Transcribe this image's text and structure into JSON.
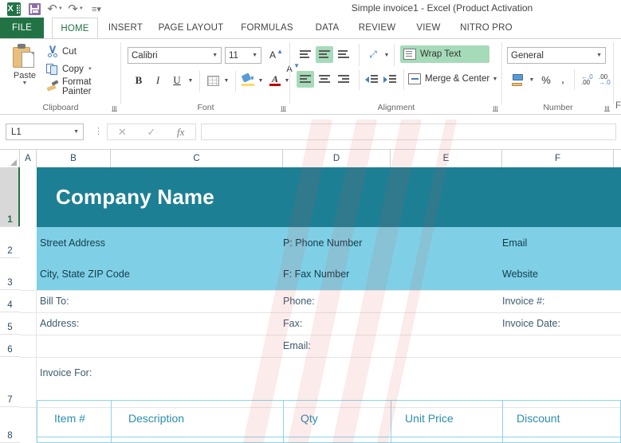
{
  "window": {
    "title": "Simple invoice1 - Excel (Product Activation",
    "quick_access": [
      {
        "name": "save-icon",
        "label": "Save"
      },
      {
        "name": "undo-icon",
        "label": "Undo"
      },
      {
        "name": "redo-icon",
        "label": "Redo"
      },
      {
        "name": "customize-qat-icon",
        "label": "Customize Quick Access Toolbar"
      }
    ]
  },
  "tabs": [
    {
      "label": "FILE",
      "active": false
    },
    {
      "label": "HOME",
      "active": true
    },
    {
      "label": "INSERT",
      "active": false
    },
    {
      "label": "PAGE LAYOUT",
      "active": false
    },
    {
      "label": "FORMULAS",
      "active": false
    },
    {
      "label": "DATA",
      "active": false
    },
    {
      "label": "REVIEW",
      "active": false
    },
    {
      "label": "VIEW",
      "active": false
    },
    {
      "label": "NITRO PRO",
      "active": false
    }
  ],
  "ribbon": {
    "clipboard": {
      "group_label": "Clipboard",
      "paste": "Paste",
      "cut": "Cut",
      "copy": "Copy",
      "format_painter": "Format Painter"
    },
    "font": {
      "group_label": "Font",
      "font_name": "Calibri",
      "font_size": "11",
      "bold": "B",
      "italic": "I",
      "underline": "U",
      "grow_font": "A",
      "shrink_font": "A",
      "borders": "Borders",
      "fill_color": "Fill Color",
      "font_color": "A"
    },
    "alignment": {
      "group_label": "Alignment",
      "top_align": "Top Align",
      "middle_align": "Middle Align",
      "bottom_align": "Bottom Align",
      "align_left": "Align Left",
      "center": "Center",
      "align_right": "Align Right",
      "orientation": "Orientation",
      "decrease_indent": "Decrease Indent",
      "increase_indent": "Increase Indent",
      "wrap_text": "Wrap Text",
      "merge_center": "Merge & Center"
    },
    "number": {
      "group_label": "Number",
      "format": "General",
      "accounting": "Accounting Number Format",
      "percent": "%",
      "comma": ",",
      "increase_decimal": ".00",
      "decrease_decimal": ".00"
    }
  },
  "formula_bar": {
    "name_box": "L1",
    "cancel": "✕",
    "enter": "✓",
    "insert_function": "fx",
    "content": ""
  },
  "grid": {
    "columns": [
      "A",
      "B",
      "C",
      "D",
      "E",
      "F"
    ],
    "rows": [
      "1",
      "2",
      "3",
      "4",
      "5",
      "6",
      "7",
      "8"
    ],
    "selected_row": "1"
  },
  "invoice": {
    "company_name": "Company Name",
    "street_address": "Street Address",
    "city_state_zip": "City, State ZIP Code",
    "phone_number": "P: Phone Number",
    "fax_number": "F: Fax Number",
    "email": "Email",
    "website": "Website",
    "bill_to": "Bill To:",
    "address": "Address:",
    "phone": "Phone:",
    "fax": "Fax:",
    "email_label": "Email:",
    "invoice_no": "Invoice #:",
    "invoice_date": "Invoice Date:",
    "invoice_for": "Invoice For:",
    "table_headers": [
      "Item #",
      "Description",
      "Qty",
      "Unit Price",
      "Discount"
    ]
  },
  "colors": {
    "excel_green": "#217346",
    "header_teal": "#1d7f94",
    "band_blue": "#7fd0e6",
    "table_header_text": "#2a8fad",
    "table_border": "#8ed5e8",
    "field_text": "#3d5a6c"
  }
}
